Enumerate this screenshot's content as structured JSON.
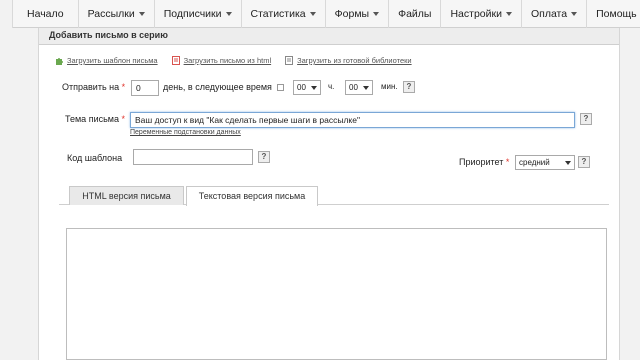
{
  "nav": {
    "items": [
      {
        "label": "Начало",
        "has_caret": false
      },
      {
        "label": "Рассылки",
        "has_caret": true
      },
      {
        "label": "Подписчики",
        "has_caret": true
      },
      {
        "label": "Статистика",
        "has_caret": true
      },
      {
        "label": "Формы",
        "has_caret": true
      },
      {
        "label": "Файлы",
        "has_caret": false
      },
      {
        "label": "Настройки",
        "has_caret": true
      },
      {
        "label": "Оплата",
        "has_caret": true
      },
      {
        "label": "Помощь",
        "has_caret": true
      }
    ]
  },
  "panel": {
    "title": "Добавить письмо в серию"
  },
  "load_links": {
    "template": "Загрузить шаблон письма",
    "html": "Загрузить письмо из html",
    "library": "Загрузить из готовой библиотеки"
  },
  "send": {
    "label": "Отправить на",
    "days_value": "0",
    "days_text": "день, в следующее время",
    "hours_value": "00",
    "hours_unit": "ч.",
    "minutes_value": "00",
    "minutes_unit": "мин."
  },
  "subject": {
    "label": "Тема письма",
    "value": "Ваш доступ к вид \"Как сделать первые шаги в рассылке\"",
    "vars_link": "Переменные подстановки данных"
  },
  "template_code": {
    "label": "Код шаблона",
    "value": ""
  },
  "priority": {
    "label": "Приоритет",
    "value": "средний"
  },
  "tabs": [
    {
      "label": "HTML версия письма",
      "active": false
    },
    {
      "label": "Текстовая версия письма",
      "active": true
    }
  ],
  "editor": {
    "value": ""
  },
  "help_glyph": "?",
  "required_mark": "*",
  "colors": {
    "required": "#e0342c",
    "focus_border": "#7aa7d6"
  }
}
